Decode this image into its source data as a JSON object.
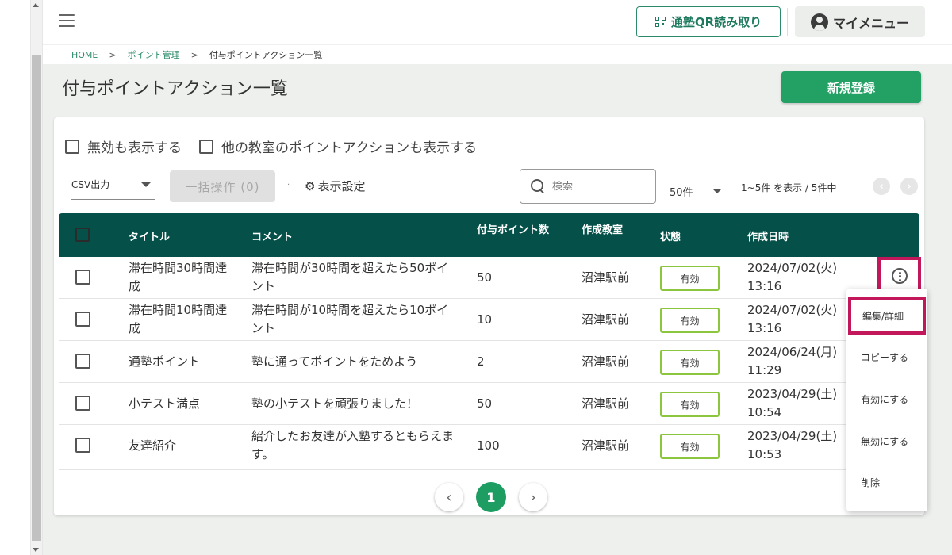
{
  "header": {
    "qr_button": "通塾QR読み取り",
    "my_menu": "マイメニュー"
  },
  "breadcrumb": {
    "home": "HOME",
    "points": "ポイント管理",
    "current": "付与ポイントアクション一覧",
    "separator": ">"
  },
  "page": {
    "title": "付与ポイントアクション一覧",
    "new_button": "新規登録"
  },
  "filters": {
    "show_disabled": "無効も表示する",
    "show_other_classrooms": "他の教室のポイントアクションも表示する"
  },
  "toolbar": {
    "csv_select": "CSV出力",
    "bulk_action": "一括操作 (0)",
    "display_settings": "表示設定",
    "search_placeholder": "検索",
    "per_page": "50件",
    "count_text": "1~5件 を表示 / 5件中"
  },
  "table": {
    "headers": {
      "title": "タイトル",
      "comment": "コメント",
      "points": "付与ポイント数",
      "classroom": "作成教室",
      "status": "状態",
      "created": "作成日時"
    },
    "rows": [
      {
        "title": "滞在時間30時間達成",
        "comment": "滞在時間が30時間を超えたら50ポイント",
        "points": "50",
        "classroom": "沼津駅前",
        "status": "有効",
        "date": "2024/07/02(火)",
        "time": "13:16"
      },
      {
        "title": "滞在時間10時間達成",
        "comment": "滞在時間が10時間を超えたら10ポイント",
        "points": "10",
        "classroom": "沼津駅前",
        "status": "有効",
        "date": "2024/07/02(火)",
        "time": "13:16"
      },
      {
        "title": "通塾ポイント",
        "comment": "塾に通ってポイントをためよう",
        "points": "2",
        "classroom": "沼津駅前",
        "status": "有効",
        "date": "2024/06/24(月)",
        "time": "11:29"
      },
      {
        "title": "小テスト満点",
        "comment": "塾の小テストを頑張りました！",
        "points": "50",
        "classroom": "沼津駅前",
        "status": "有効",
        "date": "2023/04/29(土)",
        "time": "10:54"
      },
      {
        "title": "友達紹介",
        "comment": "紹介したお友達が入塾するともらえます。",
        "points": "100",
        "classroom": "沼津駅前",
        "status": "有効",
        "date": "2023/04/29(土)",
        "time": "10:53"
      }
    ]
  },
  "context_menu": {
    "items": [
      "編集/詳細",
      "コピーする",
      "有効にする",
      "無効にする",
      "削除"
    ]
  },
  "pagination": {
    "current_page": "1"
  },
  "colors": {
    "primary_green": "#23a064",
    "table_header": "#05514a",
    "status_border": "#8cc63f",
    "highlight": "#c2185b"
  }
}
